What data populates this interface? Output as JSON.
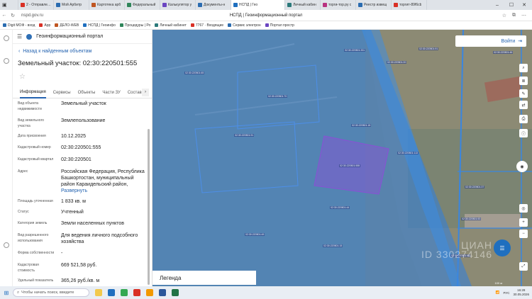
{
  "browser": {
    "tabs": [
      {
        "title": "2 - Отправленн",
        "color": "#d93025"
      },
      {
        "title": "Мой Арбитр",
        "color": "#2b6cb0"
      },
      {
        "title": "Картотека арб",
        "color": "#c05621"
      },
      {
        "title": "Федеральный",
        "color": "#2f855a"
      },
      {
        "title": "Калькулятор у",
        "color": "#6b46c1"
      },
      {
        "title": "Документы-н",
        "color": "#2b6cb0"
      },
      {
        "title": "НСПД | Гео",
        "color": "#1f6fbf",
        "active": true
      },
      {
        "title": "Личный кабин",
        "color": "#2c7a7b"
      },
      {
        "title": "торги-тор.ру с",
        "color": "#b83280"
      },
      {
        "title": "Реестр извещ",
        "color": "#2b6cb0"
      },
      {
        "title": "торгит-89f6cb",
        "color": "#d93025"
      }
    ],
    "url": "nspd.gov.ru",
    "page_title": "НСПД | Геоинформационный портал",
    "bookmarks": [
      {
        "label": "Digit МОФ - вход",
        "color": "#2b6cb0"
      },
      {
        "label": "App",
        "color": "#d93025"
      },
      {
        "label": "ДЕЛО-WEB",
        "color": "#c05621"
      },
      {
        "label": "НСПД | Геоинфо",
        "color": "#1f6fbf"
      },
      {
        "label": "Процедуры | Ро",
        "color": "#2f855a"
      },
      {
        "label": "Личный кабинет",
        "color": "#2c7a7b"
      },
      {
        "label": "7767 · Входящие",
        "color": "#d93025"
      },
      {
        "label": "Сервис электрон",
        "color": "#2b6cb0"
      },
      {
        "label": "Портал простр",
        "color": "#6b46c1"
      }
    ]
  },
  "panel": {
    "app_name": "Геоинформационный портал",
    "back_label": "Назад к найденным объектам",
    "title": "Земельный участок: 02:30:220501:555",
    "tabs": [
      "Информация",
      "Сервисы",
      "Объекты",
      "Части ЗУ",
      "Состав"
    ],
    "properties": [
      {
        "label": "Вид объекта недвижимости",
        "value": "Земельный участок"
      },
      {
        "label": "Вид земельного участка",
        "value": "Землепользование"
      },
      {
        "label": "Дата присвоения",
        "value": "10.12.2025"
      },
      {
        "label": "Кадастровый номер",
        "value": "02:30:220501:555"
      },
      {
        "label": "Кадастровый квартал",
        "value": "02:30:220501"
      },
      {
        "label": "Адрес",
        "value": "Российская Федерация, Республика Башкортостан, муниципальный район Караидельский район,",
        "link": "Развернуть"
      },
      {
        "label": "Площадь уточненная",
        "value": "1 833 кв. м"
      },
      {
        "label": "Статус",
        "value": "Учтенный"
      },
      {
        "label": "Категория земель",
        "value": "Земли населенных пунктов"
      },
      {
        "label": "Вид разрешенного использования",
        "value": "Для ведения личного подсобного хозяйства"
      },
      {
        "label": "Форма собственности",
        "value": "-"
      },
      {
        "label": "Кадастровая стоимость",
        "value": "669 521,58 руб."
      },
      {
        "label": "Удельный показатель",
        "value": "365,26 руб./кв. м"
      }
    ]
  },
  "map": {
    "login_label": "Войти",
    "legend_label": "Легенда",
    "watermark": "ЦИАН\nID 330274146",
    "scale_label": "100 м"
  },
  "taskbar": {
    "search_placeholder": "Чтобы начать поиск, введите",
    "lang": "РУС",
    "time": "16:28",
    "date": "30.05.2026"
  },
  "colors": {
    "accent": "#2463b0",
    "zone_fill": "#2f7fe0",
    "parcel": "#8b4fd6"
  }
}
